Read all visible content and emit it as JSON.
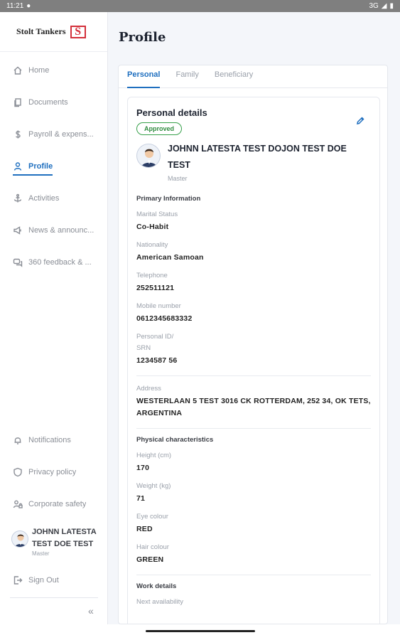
{
  "status": {
    "time": "11:21",
    "network": "3G"
  },
  "brand": {
    "name": "Stolt Tankers",
    "logo_letter": "S"
  },
  "sidebar": {
    "items": [
      {
        "label": "Home",
        "icon": "home-icon"
      },
      {
        "label": "Documents",
        "icon": "documents-icon"
      },
      {
        "label": "Payroll & expens...",
        "icon": "dollar-icon"
      },
      {
        "label": "Profile",
        "icon": "person-icon"
      },
      {
        "label": "Activities",
        "icon": "anchor-icon"
      },
      {
        "label": "News & announc...",
        "icon": "megaphone-icon"
      },
      {
        "label": "360 feedback & ...",
        "icon": "chat-icon"
      }
    ],
    "bottom_items": [
      {
        "label": "Notifications",
        "icon": "bell-icon"
      },
      {
        "label": "Privacy policy",
        "icon": "shield-icon"
      },
      {
        "label": "Corporate safety",
        "icon": "user-lock-icon"
      }
    ],
    "user": {
      "name": "JOHNN LATESTA TEST DOE TEST",
      "role": "Master"
    },
    "sign_out": "Sign Out",
    "collapse_icon": "«"
  },
  "page": {
    "title": "Profile"
  },
  "tabs": [
    "Personal",
    "Family",
    "Beneficiary"
  ],
  "details": {
    "title": "Personal details",
    "status": "Approved",
    "name": "JOHNN LATESTA TEST  DOJON TEST DOE TEST",
    "role": "Master",
    "primary_title": "Primary Information",
    "marital_label": "Marital Status",
    "marital_value": "Co-Habit",
    "nationality_label": "Nationality",
    "nationality_value": "American Samoan",
    "telephone_label": "Telephone",
    "telephone_value": "252511121",
    "mobile_label": "Mobile number",
    "mobile_value": "0612345683332",
    "personal_id_label": "Personal ID/ SRN",
    "personal_id_value": "1234587 56",
    "address_label": "Address",
    "address_value": "WESTERLAAN 5 TEST 3016 CK ROTTERDAM, 252 34, OK TETS, ARGENTINA",
    "physical_title": "Physical characteristics",
    "height_label": "Height (cm)",
    "height_value": "170",
    "weight_label": "Weight (kg)",
    "weight_value": "71",
    "eye_label": "Eye colour",
    "eye_value": "RED",
    "hair_label": "Hair colour",
    "hair_value": "GREEN",
    "work_title": "Work details",
    "availability_label": "Next availability"
  },
  "colors": {
    "accent": "#1f6fbf",
    "approved": "#37a04a",
    "brand_red": "#d32f3a"
  }
}
